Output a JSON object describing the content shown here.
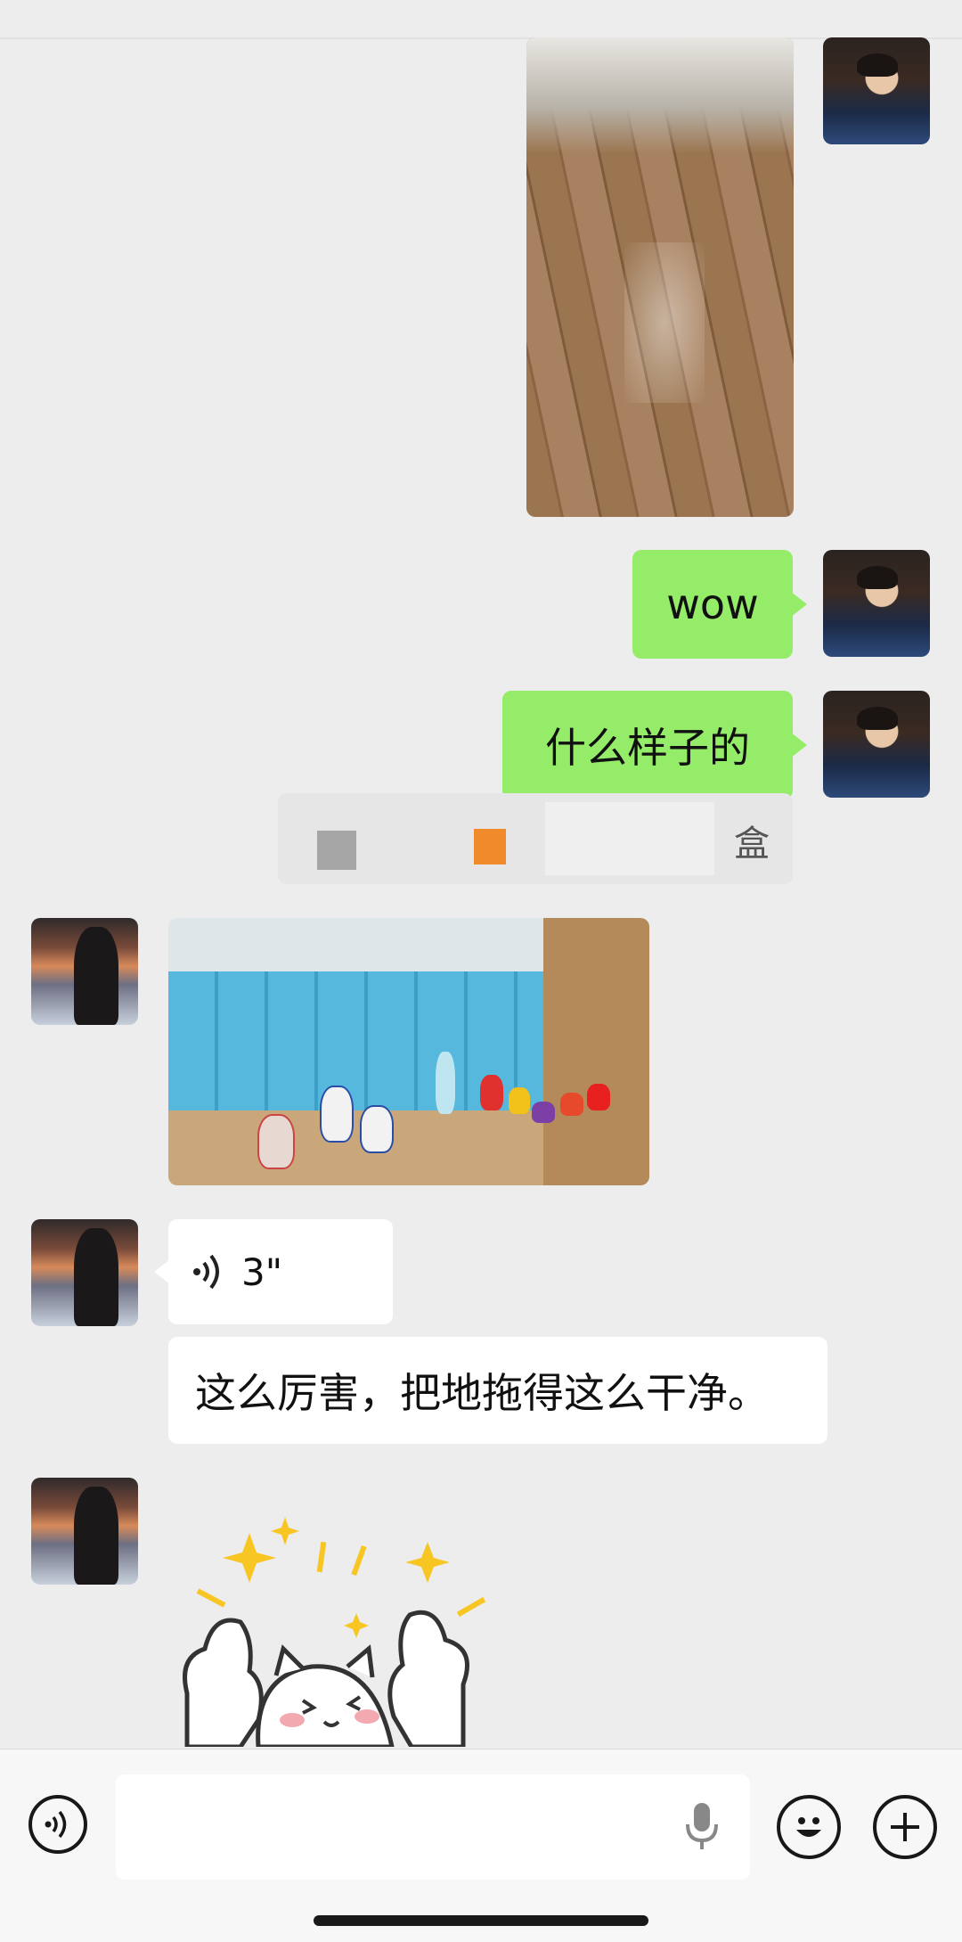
{
  "messages": {
    "wow": "wow",
    "what_kind": "什么样子的",
    "recall_suffix": "盒",
    "voice_duration": "3\"",
    "reply_text": "这么厉害，把地拖得这么干净。"
  },
  "icons": {
    "voice_toggle": "voice-wave-icon",
    "mic": "microphone-icon",
    "emoji": "emoji-face-icon",
    "plus": "plus-icon"
  },
  "colors": {
    "sent_bubble": "#95ec69",
    "received_bubble": "#ffffff",
    "background": "#ededed"
  }
}
